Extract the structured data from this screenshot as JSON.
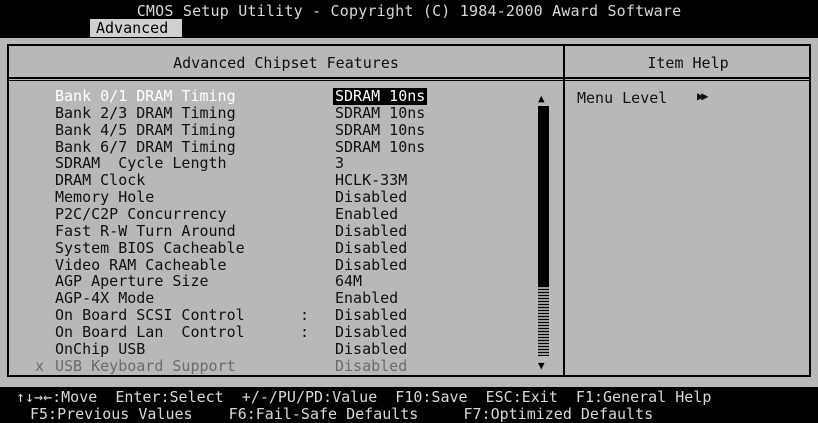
{
  "header": {
    "title": "CMOS Setup Utility - Copyright (C) 1984-2000 Award Software",
    "menu_tab": "Advanced"
  },
  "panels": {
    "left_title": "Advanced Chipset Features",
    "right_title": "Item Help"
  },
  "settings": [
    {
      "label": "Bank 0/1 DRAM Timing",
      "value": "SDRAM 10ns",
      "selected": true
    },
    {
      "label": "Bank 2/3 DRAM Timing",
      "value": "SDRAM 10ns"
    },
    {
      "label": "Bank 4/5 DRAM Timing",
      "value": "SDRAM 10ns"
    },
    {
      "label": "Bank 6/7 DRAM Timing",
      "value": "SDRAM 10ns"
    },
    {
      "label": "SDRAM  Cycle Length",
      "value": "3"
    },
    {
      "label": "DRAM Clock",
      "value": "HCLK-33M"
    },
    {
      "label": "Memory Hole",
      "value": "Disabled"
    },
    {
      "label": "P2C/C2P Concurrency",
      "value": "Enabled"
    },
    {
      "label": "Fast R-W Turn Around",
      "value": "Disabled"
    },
    {
      "label": "System BIOS Cacheable",
      "value": "Disabled"
    },
    {
      "label": "Video RAM Cacheable",
      "value": "Disabled"
    },
    {
      "label": "AGP Aperture Size",
      "value": "64M"
    },
    {
      "label": "AGP-4X Mode",
      "value": "Enabled"
    },
    {
      "label": "On Board SCSI Control",
      "sep": ":",
      "value": "Disabled"
    },
    {
      "label": "On Board Lan  Control",
      "sep": ":",
      "value": "Disabled"
    },
    {
      "label": "OnChip USB",
      "value": "Disabled"
    },
    {
      "label": "USB Keyboard Support",
      "value": "Disabled",
      "disabled": true,
      "prefix": "x"
    }
  ],
  "help": {
    "menu_level_label": "Menu Level",
    "menu_level_arrow": "▶▶"
  },
  "scrollbar": {
    "up_arrow": "▲",
    "down_arrow": "▼"
  },
  "footer": {
    "line1": "↑↓→←:Move  Enter:Select  +/-/PU/PD:Value  F10:Save  ESC:Exit  F1:General Help",
    "line2": "F5:Previous Values    F6:Fail-Safe Defaults     F7:Optimized Defaults"
  }
}
